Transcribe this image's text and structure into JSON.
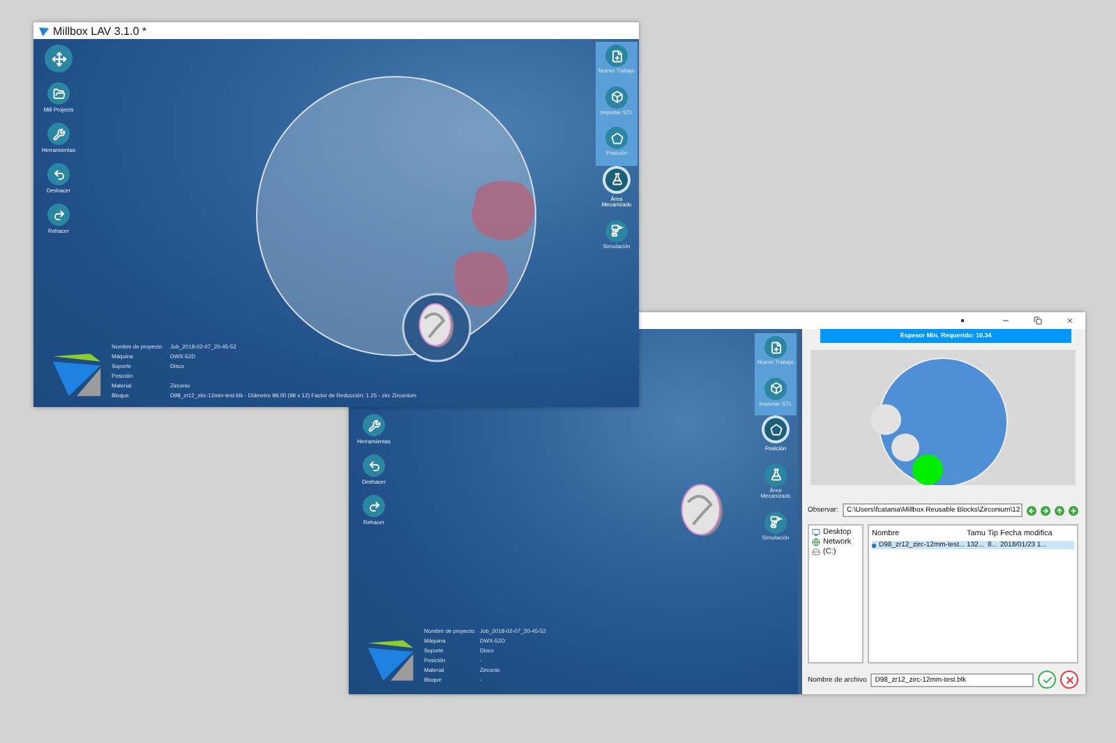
{
  "front_window": {
    "title": "Millbox LAV 3.1.0 *",
    "left_tools": [
      {
        "kind": "navigate"
      },
      {
        "kind": "projects",
        "label": "Mill Projects"
      },
      {
        "kind": "tools",
        "label": "Herramientas"
      },
      {
        "kind": "undo",
        "label": "Deshacer"
      },
      {
        "kind": "redo",
        "label": "Rehacer"
      }
    ],
    "right_tools": [
      {
        "kind": "new",
        "label": "Nuevo Trabajo",
        "selected": false
      },
      {
        "kind": "import",
        "label": "Importar STL",
        "selected": false
      },
      {
        "kind": "position",
        "label": "Posición",
        "selected": false
      },
      {
        "kind": "area",
        "label": "Área Mecanizado",
        "selected": true
      },
      {
        "kind": "simulate",
        "label": "Simulación",
        "selected": false
      }
    ],
    "project_info": [
      {
        "label": "Nombre de proyecto",
        "value": "Job_2018-02-07_20-45-52"
      },
      {
        "label": "Máquina",
        "value": "DWX-52D"
      },
      {
        "label": "Soporte",
        "value": "Disco"
      },
      {
        "label": "Posición"
      },
      {
        "label": "Material",
        "value": "Zirconio"
      },
      {
        "label": "Bloque",
        "value": "D98_zr12_zirc-12mm-test.blk - Diámetro 98.00 (98 x 12) Factor de Reducción: 1.25 - zirc Zirconium"
      }
    ]
  },
  "back_window": {
    "left_tools": [
      {
        "kind": "tools",
        "label": "Herramientas"
      },
      {
        "kind": "undo",
        "label": "Deshacer"
      },
      {
        "kind": "redo",
        "label": "Rehacer"
      }
    ],
    "right_tools": [
      {
        "kind": "new",
        "label": "Nuevo Trabajo",
        "selected": false
      },
      {
        "kind": "import",
        "label": "Importar STL",
        "selected": false
      },
      {
        "kind": "position",
        "label": "Posición",
        "selected": true
      },
      {
        "kind": "area",
        "label": "Área Mecanizado",
        "selected": false
      },
      {
        "kind": "simulate",
        "label": "Simulación",
        "selected": false
      }
    ],
    "project_info": [
      {
        "label": "Nombre de proyecto",
        "value": "Job_2018-02-07_20-45-52"
      },
      {
        "label": "Máquina",
        "value": "DWX-52D"
      },
      {
        "label": "Soporte",
        "value": "Disco"
      },
      {
        "label": "Posición",
        "value": "-"
      },
      {
        "label": "Material",
        "value": "Zirconio"
      },
      {
        "label": "Bloque",
        "value": "-"
      }
    ],
    "dialog": {
      "banner": "Espesor Min. Requerido: 10.34",
      "look_in_label": "Observar:",
      "look_in_value": "C:\\Users\\fcatania\\Millbox Reusable Blocks\\Zirconium\\12",
      "places": [
        {
          "kind": "desktop",
          "label": "Desktop"
        },
        {
          "kind": "network",
          "label": "Network"
        },
        {
          "kind": "drive",
          "label": "(C:)"
        }
      ],
      "columns": [
        "Nombre",
        "Tamu",
        "Tip",
        "Fecha modifica"
      ],
      "files": [
        {
          "cells": [
            "D98_zr12_zirc-12mm-test...",
            "132...",
            "8...",
            "2018/01/23 1..."
          ],
          "selected": true
        }
      ],
      "filename_label": "Nombre de archivo",
      "filename_value": "D98_zr12_zirc-12mm-test.blk"
    }
  }
}
